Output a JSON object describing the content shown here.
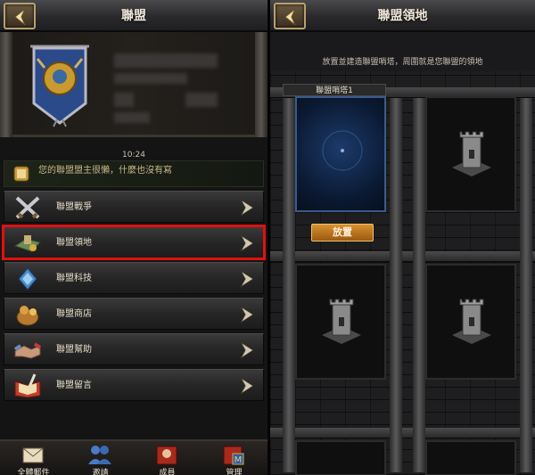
{
  "left": {
    "header": {
      "title": "聯盟"
    },
    "time": "10:24",
    "message": "您的聯盟盟主很懶，什麼也沒有寫",
    "menu": [
      {
        "label": "聯盟戰爭",
        "icon": "crossed-swords-icon"
      },
      {
        "label": "聯盟領地",
        "icon": "territory-map-icon",
        "highlighted": true
      },
      {
        "label": "聯盟科技",
        "icon": "tech-crystal-icon"
      },
      {
        "label": "聯盟商店",
        "icon": "shop-bag-icon"
      },
      {
        "label": "聯盟幫助",
        "icon": "handshake-icon"
      },
      {
        "label": "聯盟留言",
        "icon": "book-quill-icon"
      }
    ],
    "tabs": [
      {
        "label": "全體郵件",
        "icon": "mail-icon"
      },
      {
        "label": "邀請",
        "icon": "invite-people-icon"
      },
      {
        "label": "成員",
        "icon": "members-icon"
      },
      {
        "label": "管理",
        "icon": "manage-icon"
      }
    ]
  },
  "right": {
    "header": {
      "title": "聯盟領地"
    },
    "hint": "放置並建造聯盟哨塔，周圍就是您聯盟的領地",
    "slot1_label": "聯盟哨塔1",
    "place_button": "放置"
  },
  "colors": {
    "highlight": "#e01010",
    "accent": "#d89030"
  }
}
